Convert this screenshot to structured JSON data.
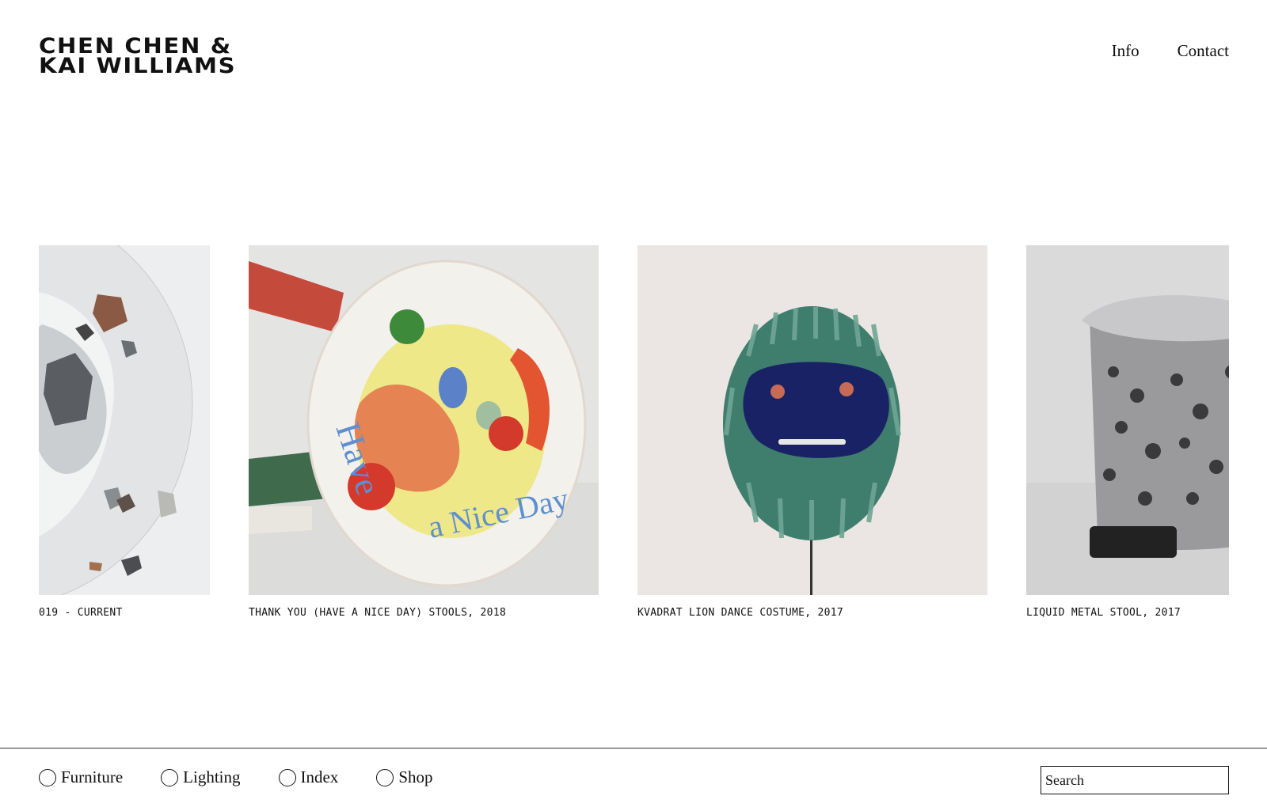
{
  "brand": {
    "line1": "CHEN CHEN &",
    "line2": "KAI WILLIAMS"
  },
  "nav": {
    "info": "Info",
    "contact": "Contact"
  },
  "works": [
    {
      "caption": "019 - CURRENT",
      "image": "terrazzo-resin-table-photo"
    },
    {
      "caption": "THANK YOU (HAVE A NICE DAY) STOOLS, 2018",
      "image": "plastic-bag-stool-photo"
    },
    {
      "caption": "KVADRAT LION DANCE COSTUME, 2017",
      "image": "green-fringe-mask-photo"
    },
    {
      "caption": "LIQUID METAL STOOL, 2017",
      "image": "aluminum-foam-stool-photo"
    }
  ],
  "categories": [
    {
      "label": "Furniture",
      "icon": "radio-circle-icon"
    },
    {
      "label": "Lighting",
      "icon": "radio-circle-icon"
    },
    {
      "label": "Index",
      "icon": "radio-circle-icon"
    },
    {
      "label": "Shop",
      "icon": "radio-circle-icon"
    }
  ],
  "search": {
    "placeholder": "Search"
  },
  "colors": {
    "text": "#111111",
    "background": "#ffffff",
    "border": "#333333"
  }
}
